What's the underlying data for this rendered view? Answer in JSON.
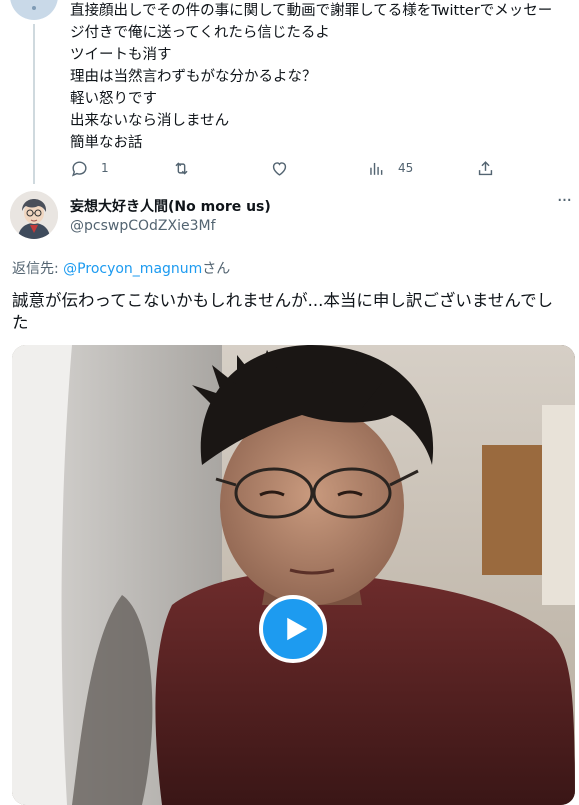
{
  "parent_tweet": {
    "text_lines": [
      "直接顔出しでその件の事に関して動画で謝罪してる様をTwitterでメッセー",
      "ジ付きで俺に送ってくれたら信じたるよ",
      "ツイートも消す",
      "理由は当然言わずもがな分かるよな？",
      "軽い怒りです",
      "出来ないなら消しません",
      "簡単なお話"
    ],
    "actions": {
      "reply_count": "1",
      "views_count": "45"
    }
  },
  "reply_tweet": {
    "display_name": "妄想大好き人間(No more us)",
    "handle": "@pcswpCOdZXie3Mf",
    "more_label": "···",
    "reply_prefix": "返信先: ",
    "reply_mention": "@Procyon_magnum",
    "reply_suffix": "さん",
    "text_lines": [
      "誠意が伝わってこないかもしれませんが...本当に申し訳ございませんでし",
      "た"
    ]
  },
  "colors": {
    "link_blue": "#1d9bf0",
    "secondary_text": "#536471",
    "primary_text": "#0f1419",
    "thread_line": "#cfd9de"
  },
  "icons": [
    "reply-icon",
    "retweet-icon",
    "like-icon",
    "views-icon",
    "share-icon",
    "more-icon",
    "play-icon"
  ]
}
